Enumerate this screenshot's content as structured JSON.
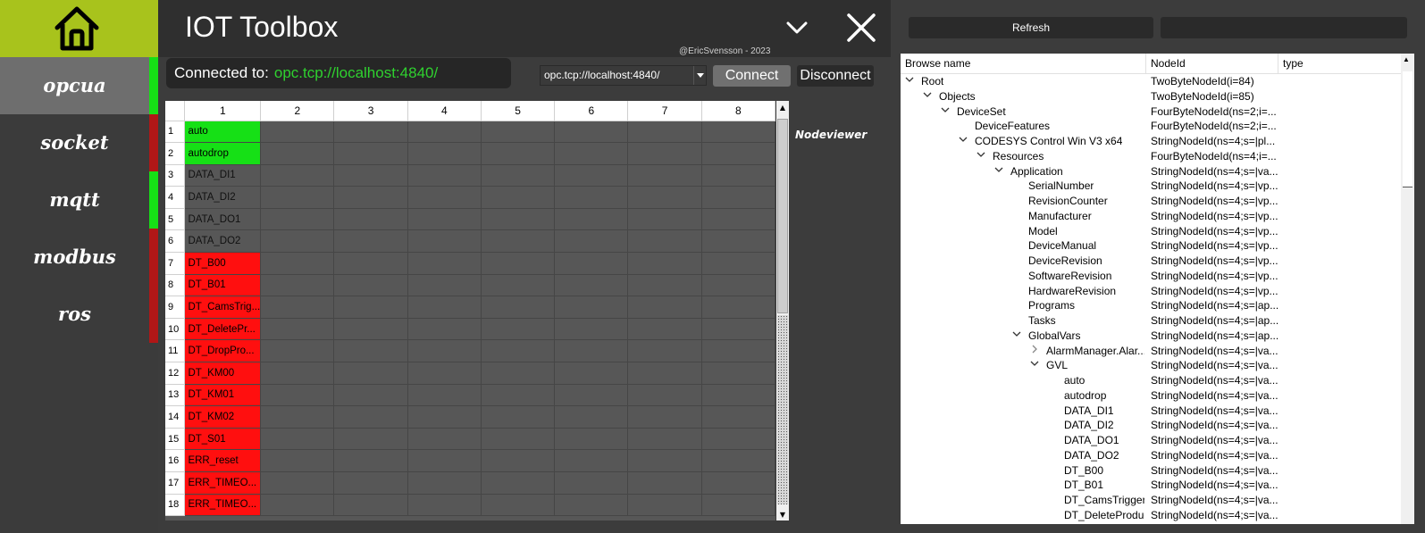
{
  "app": {
    "title": "IOT Toolbox",
    "credit": "@EricSvensson - 2023"
  },
  "colors": {
    "accent": "#a8c31c",
    "status_green": "#16e016",
    "status_red": "#ff0f0f",
    "connected_text": "#2fd12f"
  },
  "icons": {
    "home": "home-icon",
    "minimize": "chevron-down-icon",
    "close": "close-icon"
  },
  "sidebar": {
    "items": [
      {
        "label": "opcua",
        "status": "green",
        "active": true
      },
      {
        "label": "socket",
        "status": "red",
        "active": false
      },
      {
        "label": "mqtt",
        "status": "green",
        "active": false
      },
      {
        "label": "modbus",
        "status": "red",
        "active": false
      },
      {
        "label": "ros",
        "status": "red",
        "active": false
      }
    ]
  },
  "connection": {
    "label": "Connected to:",
    "url": "opc.tcp://localhost:4840/",
    "select_value": "opc.tcp://localhost:4840/",
    "connect_label": "Connect",
    "disconnect_label": "Disconnect"
  },
  "grid": {
    "columns": [
      "1",
      "2",
      "3",
      "4",
      "5",
      "6",
      "7",
      "8"
    ],
    "rows": [
      {
        "num": "1",
        "value": "auto",
        "state": "green"
      },
      {
        "num": "2",
        "value": "autodrop",
        "state": "green"
      },
      {
        "num": "3",
        "value": "DATA_DI1",
        "state": "gray"
      },
      {
        "num": "4",
        "value": "DATA_DI2",
        "state": "gray"
      },
      {
        "num": "5",
        "value": "DATA_DO1",
        "state": "gray"
      },
      {
        "num": "6",
        "value": "DATA_DO2",
        "state": "gray"
      },
      {
        "num": "7",
        "value": "DT_B00",
        "state": "red"
      },
      {
        "num": "8",
        "value": "DT_B01",
        "state": "red"
      },
      {
        "num": "9",
        "value": "DT_CamsTrig...",
        "state": "red"
      },
      {
        "num": "10",
        "value": "DT_DeletePr...",
        "state": "red"
      },
      {
        "num": "11",
        "value": "DT_DropPro...",
        "state": "red"
      },
      {
        "num": "12",
        "value": "DT_KM00",
        "state": "red"
      },
      {
        "num": "13",
        "value": "DT_KM01",
        "state": "red"
      },
      {
        "num": "14",
        "value": "DT_KM02",
        "state": "red"
      },
      {
        "num": "15",
        "value": "DT_S01",
        "state": "red"
      },
      {
        "num": "16",
        "value": "ERR_reset",
        "state": "red"
      },
      {
        "num": "17",
        "value": "ERR_TIMEO...",
        "state": "red"
      },
      {
        "num": "18",
        "value": "ERR_TIMEO...",
        "state": "red"
      }
    ]
  },
  "nodeviewer_label": "Nodeviewer",
  "browser": {
    "refresh_label": "Refresh",
    "columns": [
      "Browse name",
      "NodeId",
      "type"
    ],
    "rows": [
      {
        "depth": 0,
        "expander": "open",
        "name": "Root",
        "nodeid": "TwoByteNodeId(i=84)"
      },
      {
        "depth": 1,
        "expander": "open",
        "name": "Objects",
        "nodeid": "TwoByteNodeId(i=85)"
      },
      {
        "depth": 2,
        "expander": "open",
        "name": "DeviceSet",
        "nodeid": "FourByteNodeId(ns=2;i=..."
      },
      {
        "depth": 3,
        "expander": "none",
        "name": "DeviceFeatures",
        "nodeid": "FourByteNodeId(ns=2;i=..."
      },
      {
        "depth": 3,
        "expander": "open",
        "name": "CODESYS Control Win V3 x64",
        "nodeid": "StringNodeId(ns=4;s=|pl..."
      },
      {
        "depth": 4,
        "expander": "open",
        "name": "Resources",
        "nodeid": "FourByteNodeId(ns=4;i=..."
      },
      {
        "depth": 5,
        "expander": "open",
        "name": "Application",
        "nodeid": "StringNodeId(ns=4;s=|va..."
      },
      {
        "depth": 6,
        "expander": "none",
        "name": "SerialNumber",
        "nodeid": "StringNodeId(ns=4;s=|vp..."
      },
      {
        "depth": 6,
        "expander": "none",
        "name": "RevisionCounter",
        "nodeid": "StringNodeId(ns=4;s=|vp..."
      },
      {
        "depth": 6,
        "expander": "none",
        "name": "Manufacturer",
        "nodeid": "StringNodeId(ns=4;s=|vp..."
      },
      {
        "depth": 6,
        "expander": "none",
        "name": "Model",
        "nodeid": "StringNodeId(ns=4;s=|vp..."
      },
      {
        "depth": 6,
        "expander": "none",
        "name": "DeviceManual",
        "nodeid": "StringNodeId(ns=4;s=|vp..."
      },
      {
        "depth": 6,
        "expander": "none",
        "name": "DeviceRevision",
        "nodeid": "StringNodeId(ns=4;s=|vp..."
      },
      {
        "depth": 6,
        "expander": "none",
        "name": "SoftwareRevision",
        "nodeid": "StringNodeId(ns=4;s=|vp..."
      },
      {
        "depth": 6,
        "expander": "none",
        "name": "HardwareRevision",
        "nodeid": "StringNodeId(ns=4;s=|vp..."
      },
      {
        "depth": 6,
        "expander": "none",
        "name": "Programs",
        "nodeid": "StringNodeId(ns=4;s=|ap..."
      },
      {
        "depth": 6,
        "expander": "none",
        "name": "Tasks",
        "nodeid": "StringNodeId(ns=4;s=|ap..."
      },
      {
        "depth": 6,
        "expander": "open",
        "name": "GlobalVars",
        "nodeid": "StringNodeId(ns=4;s=|ap..."
      },
      {
        "depth": 7,
        "expander": "closed",
        "name": "AlarmManager.Alar...",
        "nodeid": "StringNodeId(ns=4;s=|va..."
      },
      {
        "depth": 7,
        "expander": "open",
        "name": "GVL",
        "nodeid": "StringNodeId(ns=4;s=|va..."
      },
      {
        "depth": 8,
        "expander": "none",
        "name": "auto",
        "nodeid": "StringNodeId(ns=4;s=|va..."
      },
      {
        "depth": 8,
        "expander": "none",
        "name": "autodrop",
        "nodeid": "StringNodeId(ns=4;s=|va..."
      },
      {
        "depth": 8,
        "expander": "none",
        "name": "DATA_DI1",
        "nodeid": "StringNodeId(ns=4;s=|va..."
      },
      {
        "depth": 8,
        "expander": "none",
        "name": "DATA_DI2",
        "nodeid": "StringNodeId(ns=4;s=|va..."
      },
      {
        "depth": 8,
        "expander": "none",
        "name": "DATA_DO1",
        "nodeid": "StringNodeId(ns=4;s=|va..."
      },
      {
        "depth": 8,
        "expander": "none",
        "name": "DATA_DO2",
        "nodeid": "StringNodeId(ns=4;s=|va..."
      },
      {
        "depth": 8,
        "expander": "none",
        "name": "DT_B00",
        "nodeid": "StringNodeId(ns=4;s=|va..."
      },
      {
        "depth": 8,
        "expander": "none",
        "name": "DT_B01",
        "nodeid": "StringNodeId(ns=4;s=|va..."
      },
      {
        "depth": 8,
        "expander": "none",
        "name": "DT_CamsTrigger",
        "nodeid": "StringNodeId(ns=4;s=|va..."
      },
      {
        "depth": 8,
        "expander": "none",
        "name": "DT_DeleteProduct",
        "nodeid": "StringNodeId(ns=4;s=|va..."
      }
    ]
  }
}
